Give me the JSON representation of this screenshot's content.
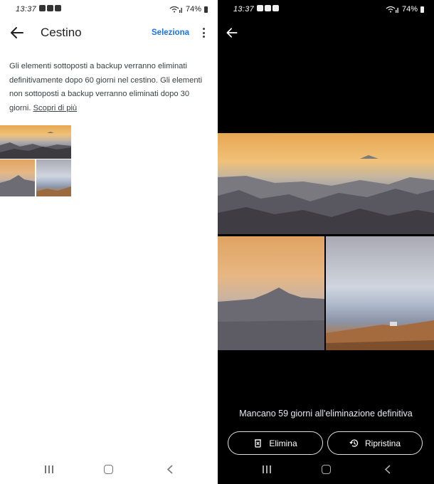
{
  "status_bar": {
    "time": "13:37",
    "battery": "74%"
  },
  "trash": {
    "title": "Cestino",
    "select_label": "Seleziona",
    "info_text": "Gli elementi sottoposti a backup verranno eliminati definitivamente dopo 60 giorni nel cestino. Gli elementi non sottoposti a backup verranno eliminati dopo 30 giorni.",
    "learn_more": "Scopri di più"
  },
  "viewer": {
    "deadline_text": "Mancano 59 giorni all'eliminazione definitiva",
    "delete_label": "Elimina",
    "restore_label": "Ripristina"
  },
  "icons": {
    "back": "arrow-back-icon",
    "more": "more-vert-icon",
    "delete": "delete-icon",
    "restore": "restore-icon",
    "nav_recent": "recent-apps-icon",
    "nav_home": "home-icon",
    "nav_back": "nav-back-icon"
  },
  "colors": {
    "accent": "#1a73e8",
    "viewer_bg": "#000000"
  }
}
